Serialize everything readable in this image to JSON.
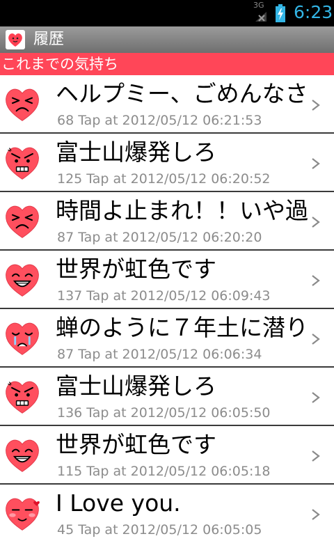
{
  "status_bar": {
    "network_label": "3G",
    "time": "6:23",
    "time_color": "#33b5e5"
  },
  "app": {
    "title": "履歴",
    "icon": "heart-face-icon"
  },
  "section": {
    "header": "これまでの気持ち",
    "color": "#ff4658"
  },
  "history": [
    {
      "message": "ヘルプミー、ごめんなさ",
      "meta": "68 Tap at 2012/05/12 06:21:53",
      "face": "troubled-face-icon"
    },
    {
      "message": "富士山爆発しろ",
      "meta": "125 Tap at 2012/05/12 06:20:52",
      "face": "angry-face-icon"
    },
    {
      "message": "時間よ止まれ！！いや過",
      "meta": "87 Tap at 2012/05/12 06:20:20",
      "face": "troubled-face-icon"
    },
    {
      "message": "世界が虹色です",
      "meta": "137 Tap at 2012/05/12 06:09:43",
      "face": "laughing-face-icon"
    },
    {
      "message": "蝉のように７年土に潜り",
      "meta": "87 Tap at 2012/05/12 06:06:34",
      "face": "crying-face-icon"
    },
    {
      "message": "富士山爆発しろ",
      "meta": "136 Tap at 2012/05/12 06:05:50",
      "face": "angry-face-icon"
    },
    {
      "message": "世界が虹色です",
      "meta": "115 Tap at 2012/05/12 06:05:18",
      "face": "laughing-face-icon"
    },
    {
      "message": "I Love you.",
      "meta": "45 Tap at 2012/05/12 06:05:05",
      "face": "love-face-icon"
    }
  ],
  "colors": {
    "heart": "#ff4f5e",
    "meta_text": "#8c8c8c"
  }
}
